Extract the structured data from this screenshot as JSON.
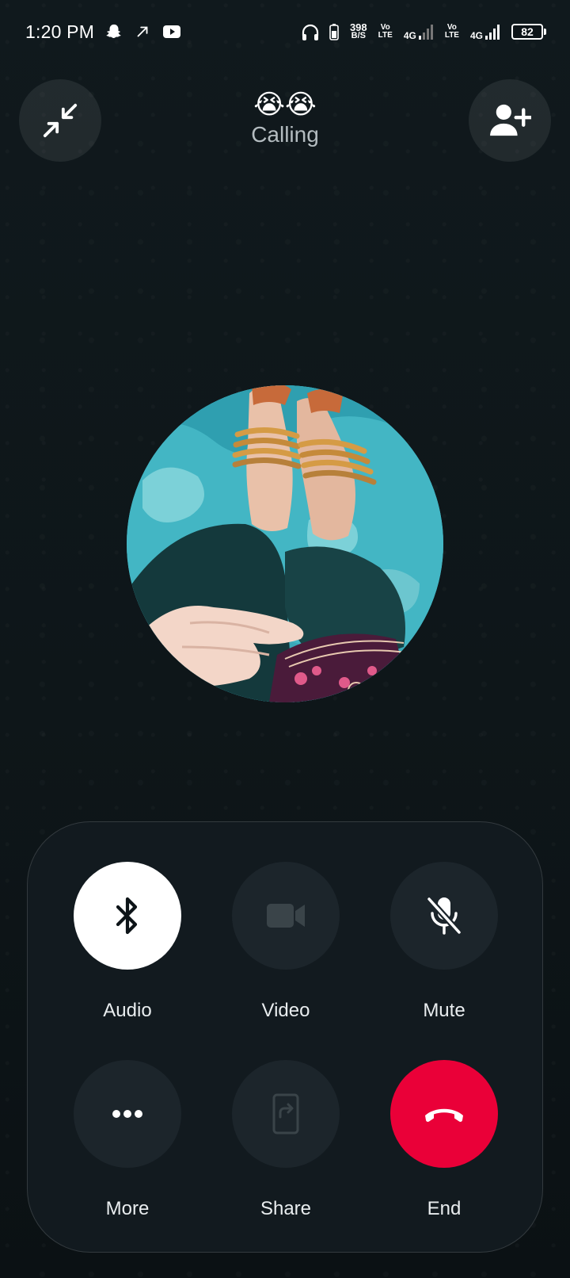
{
  "status_bar": {
    "time": "1:20 PM",
    "net_speed_value": "398",
    "net_speed_unit": "B/S",
    "sim1_top": "Vo",
    "sim1_bottom": "LTE",
    "sim1_network": "4G",
    "sim2_top": "Vo",
    "sim2_bottom": "LTE",
    "sim2_network": "4G",
    "battery_level": "82",
    "icons": [
      "snapchat-icon",
      "navigation-arrow-icon",
      "youtube-icon",
      "headphones-icon",
      "battery-saver-icon",
      "signal-icon",
      "signal-icon"
    ]
  },
  "header": {
    "caller_name": "😭😭",
    "call_status": "Calling",
    "minimize_icon": "minimize-arrows-icon",
    "add_participant_icon": "add-person-icon"
  },
  "avatar": {
    "description_icon": "profile-photo"
  },
  "controls": {
    "audio_label": "Audio",
    "video_label": "Video",
    "mute_label": "Mute",
    "more_label": "More",
    "share_label": "Share",
    "end_label": "End"
  },
  "colors": {
    "background": "#0d1418",
    "panel": "#121a1f",
    "button": "#1c252b",
    "audio_active": "#ffffff",
    "end_call": "#ea0038"
  }
}
